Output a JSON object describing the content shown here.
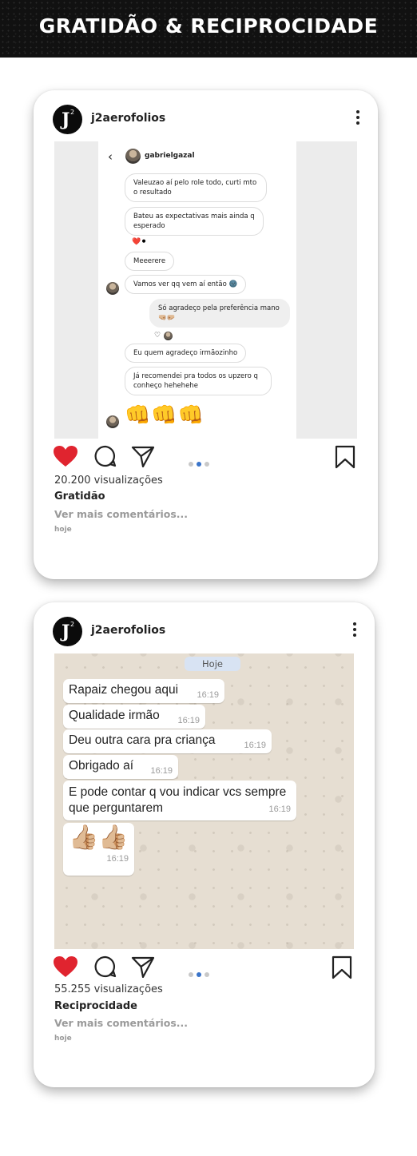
{
  "banner": {
    "title": "GRATIDÃO & RECIPROCIDADE"
  },
  "posts": [
    {
      "username": "j2aerofolios",
      "views": "20.200 visualizações",
      "caption": "Gratidão",
      "more_comments": "Ver mais comentários...",
      "date": "hoje",
      "dm": {
        "contact": "gabrielgazal",
        "messages": [
          "Valeuzao aí pelo role todo, curti mto o resultado",
          "Bateu as expectativas mais ainda q esperado",
          "Meeerere",
          "Vamos ver qq vem aí então 🌚",
          "Só agradeço pela preferência mano 🤜🏼🤛🏼",
          "Eu quem agradeço irmãozinho",
          "Já recomendei pra todos os upzero q conheço hehehehe"
        ],
        "fists": "👊👊👊"
      }
    },
    {
      "username": "j2aerofolios",
      "views": "55.255 visualizações",
      "caption": "Reciprocidade",
      "more_comments": "Ver mais comentários...",
      "date": "hoje",
      "wa": {
        "day": "Hoje",
        "messages": [
          {
            "text": "Rapaiz chegou aqui",
            "time": "16:19"
          },
          {
            "text": "Qualidade irmão",
            "time": "16:19"
          },
          {
            "text": "Deu outra cara pra criança",
            "time": "16:19"
          },
          {
            "text": "Obrigado aí",
            "time": "16:19"
          },
          {
            "text": "E pode contar q vou indicar vcs sempre que perguntarem",
            "time": "16:19"
          },
          {
            "text": "👍🏼👍🏼",
            "time": "16:19"
          }
        ]
      }
    }
  ],
  "colors": {
    "heart": "#e0242f",
    "dot_active": "#3a74c9",
    "banner_bg": "#111111"
  }
}
